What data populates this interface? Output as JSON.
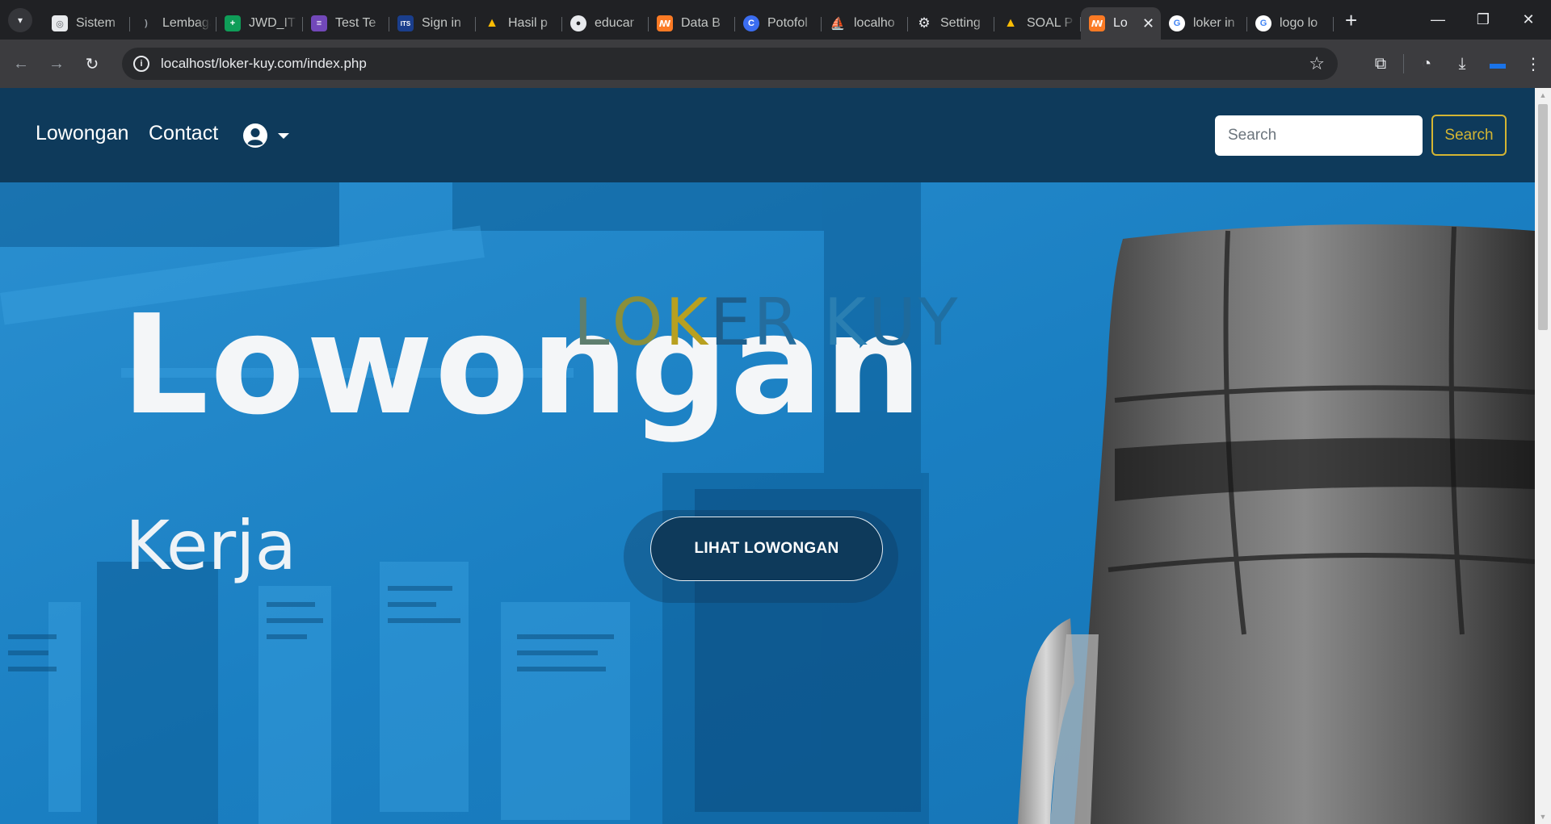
{
  "browser": {
    "tabs": [
      {
        "title": "Sistem",
        "icon": "sistem-favicon",
        "color": "#8ab4f8"
      },
      {
        "title": "Lembaga",
        "icon": "lembaga-favicon",
        "color": "#5f6368"
      },
      {
        "title": "JWD_IT",
        "icon": "sheets-icon",
        "color": "#0f9d58"
      },
      {
        "title": "Test Te",
        "icon": "forms-icon",
        "color": "#7248b9"
      },
      {
        "title": "Sign in",
        "icon": "its-icon",
        "color": "#1a3e8c"
      },
      {
        "title": "Hasil p",
        "icon": "drive-icon",
        "color": "#fbbc04"
      },
      {
        "title": "educar",
        "icon": "github-icon",
        "color": "#e8eaed"
      },
      {
        "title": "Data B",
        "icon": "xampp-icon",
        "color": "#fb7a24"
      },
      {
        "title": "Potofol",
        "icon": "canva-icon",
        "color": "#00c4cc"
      },
      {
        "title": "localho",
        "icon": "phpmyadmin-icon",
        "color": "#f29111"
      },
      {
        "title": "Setting",
        "icon": "gear-icon",
        "color": "#e8eaed"
      },
      {
        "title": "SOAL P",
        "icon": "drive-icon",
        "color": "#fbbc04"
      },
      {
        "title": "Lo",
        "icon": "xampp-icon",
        "color": "#fb7a24",
        "active": true
      },
      {
        "title": "loker in",
        "icon": "google-icon",
        "color": "#ffffff"
      },
      {
        "title": "logo lo",
        "icon": "google-icon",
        "color": "#ffffff"
      }
    ],
    "url": "localhost/loker-kuy.com/index.php"
  },
  "nav": {
    "links": [
      "Lowongan",
      "Contact"
    ],
    "user_icon": "user-circle-icon",
    "search": {
      "placeholder": "Search",
      "button": "Search"
    }
  },
  "hero": {
    "word1": "Lowongan",
    "word2": "Kerja",
    "brand": "LOKER KUY",
    "cta": "LIHAT LOWONGAN"
  },
  "colors": {
    "navbar": "#0e3a5b",
    "search_accent": "#d4b533",
    "hero_blue": "#1e86c9"
  }
}
